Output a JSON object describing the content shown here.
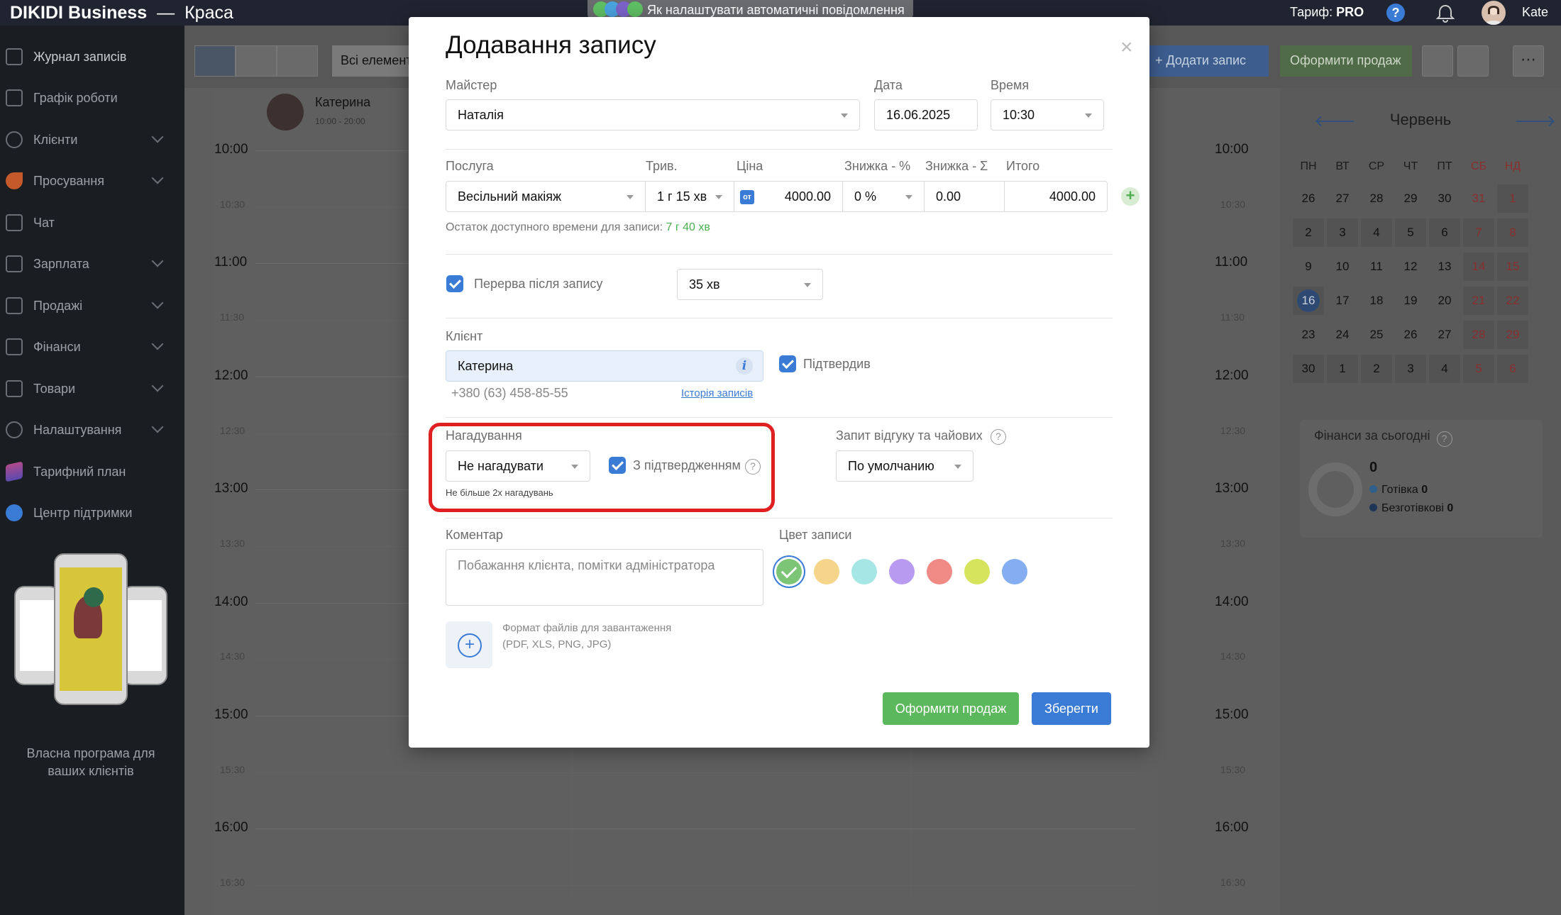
{
  "topbar": {
    "brand_name": "DIKIDI Business",
    "brand_sep": "—",
    "brand_company": "Краса",
    "hint_text": "Як налаштувати автоматичні повідомлення",
    "tariff_label": "Тариф:",
    "tariff_value": "PRO",
    "help_glyph": "?",
    "user_name": "Kate"
  },
  "sidebar": {
    "items": [
      {
        "label": "Журнал записів",
        "icon": "journal-icon"
      },
      {
        "label": "Графік роботи",
        "icon": "schedule-icon"
      },
      {
        "label": "Клієнти",
        "icon": "clients-icon"
      },
      {
        "label": "Просування",
        "icon": "rocket-icon"
      },
      {
        "label": "Чат",
        "icon": "chat-icon"
      },
      {
        "label": "Зарплата",
        "icon": "salary-icon"
      },
      {
        "label": "Продажі",
        "icon": "sales-icon"
      },
      {
        "label": "Фінанси",
        "icon": "finance-icon"
      },
      {
        "label": "Товари",
        "icon": "goods-icon"
      },
      {
        "label": "Налаштування",
        "icon": "gear-icon"
      },
      {
        "label": "Тарифний план",
        "icon": "layers-icon"
      },
      {
        "label": "Центр підтримки",
        "icon": "help-icon"
      }
    ],
    "promo_text": "Власна програма для ваших клієнтів"
  },
  "toolbar": {
    "all_elements": "Всі елементи",
    "add_record": "+ Додати запис",
    "make_sale": "Оформити продаж",
    "more_glyph": "⋯"
  },
  "calendar": {
    "master_name": "Катерина",
    "master_hours": "10:00 - 20:00",
    "times": [
      "10:00",
      "10:30",
      "11:00",
      "11:30",
      "12:00",
      "12:30",
      "13:00",
      "13:30",
      "14:00",
      "14:30",
      "15:00",
      "15:30",
      "16:00",
      "16:30"
    ]
  },
  "mini_calendar": {
    "month": "Червень",
    "prev_glyph": "🡐",
    "next_glyph": "🡒",
    "weekdays": [
      "ПН",
      "ВТ",
      "СР",
      "ЧТ",
      "ПТ",
      "СБ",
      "НД"
    ],
    "weeks": [
      [
        "26",
        "27",
        "28",
        "29",
        "30",
        "31",
        "1"
      ],
      [
        "2",
        "3",
        "4",
        "5",
        "6",
        "7",
        "8"
      ],
      [
        "9",
        "10",
        "11",
        "12",
        "13",
        "14",
        "15"
      ],
      [
        "16",
        "17",
        "18",
        "19",
        "20",
        "21",
        "22"
      ],
      [
        "23",
        "24",
        "25",
        "26",
        "27",
        "28",
        "29"
      ],
      [
        "30",
        "1",
        "2",
        "3",
        "4",
        "5",
        "6"
      ]
    ],
    "today": "16"
  },
  "finance": {
    "title": "Фінанси за сьогодні",
    "total": "0",
    "cash_label": "Готівка",
    "cash_value": "0",
    "noncash_label": "Безготівкові",
    "noncash_value": "0",
    "help_glyph": "?"
  },
  "modal": {
    "title": "Додавання запису",
    "close_glyph": "×",
    "master_label": "Майстер",
    "master_value": "Наталія",
    "date_label": "Дата",
    "date_value": "16.06.2025",
    "time_label": "Время",
    "time_value": "10:30",
    "service_label": "Послуга",
    "service_value": "Весільний макіяж",
    "duration_label": "Трив.",
    "duration_value": "1 г 15 хв",
    "price_label": "Ціна",
    "price_badge": "от",
    "price_value": "4000.00",
    "discount_pct_label": "Знижка - %",
    "discount_pct_value": "0 %",
    "discount_sum_label": "Знижка - Σ",
    "discount_sum_value": "0.00",
    "total_label": "Итого",
    "total_value": "4000.00",
    "add_service_glyph": "+",
    "remaining_text": "Остаток доступного времени для записи:",
    "remaining_value": "7 г 40 хв",
    "break_label": "Перерва після запису",
    "break_value": "35 хв",
    "client_label": "Клієнт",
    "client_value": "Катерина",
    "client_info_glyph": "i",
    "confirmed_label": "Підтвердив",
    "client_phone": "+380 (63) 458-85-55",
    "history_link": "Історія записів",
    "reminder_label": "Нагадування",
    "reminder_value": "Не нагадувати",
    "with_confirmation_label": "З підтвердженням",
    "reminder_note": "Не більше 2х нагадувань",
    "feedback_label": "Запит відгуку та чайових",
    "feedback_value": "По умолчанию",
    "help_glyph": "?",
    "comment_label": "Коментар",
    "comment_placeholder": "Побажання клієнта, помітки адміністратора",
    "upload_text": "Формат файлів для завантаження (PDF, XLS, PNG, JPG)",
    "color_label": "Цвет записи",
    "colors": [
      "#7cc576",
      "#f5d58a",
      "#a6e6e4",
      "#b89af0",
      "#ef8a85",
      "#d6e35c",
      "#85aef2"
    ],
    "btn_sale": "Оформити продаж",
    "btn_save": "Зберегти"
  }
}
